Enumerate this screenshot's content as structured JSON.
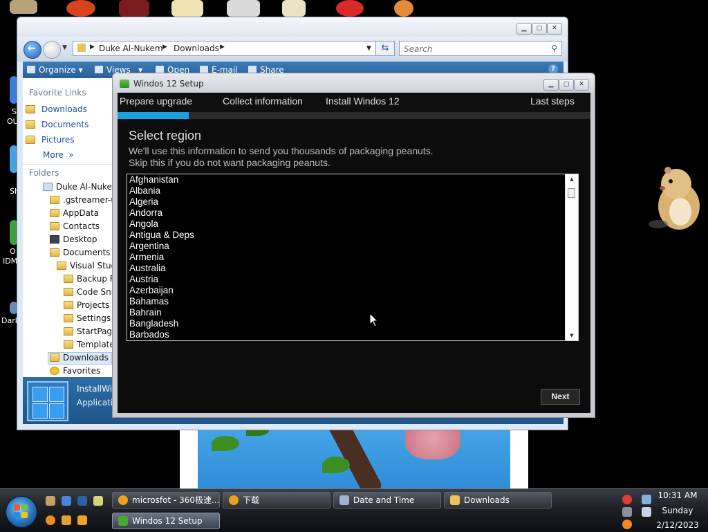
{
  "explorer": {
    "address": [
      "Duke Al-Nukem",
      "Downloads"
    ],
    "search_placeholder": "Search",
    "toolbar": {
      "organize": "Organize",
      "views": "Views",
      "open": "Open",
      "email": "E-mail",
      "share": "Share"
    },
    "favorite_links": {
      "heading": "Favorite Links",
      "items": [
        "Downloads",
        "Documents",
        "Pictures"
      ],
      "more": "More"
    },
    "folders_heading": "Folders",
    "tree": [
      "Duke Al-Nukem",
      ".gstreamer-0.",
      "AppData",
      "Contacts",
      "Desktop",
      "Documents",
      "Visual Studi",
      "Backup Fi",
      "Code Snip",
      "Projects",
      "Settings",
      "StartPage",
      "Template",
      "Downloads",
      "Favorites"
    ],
    "details": {
      "name": "InstallWi",
      "type": "Applicatio"
    }
  },
  "setup": {
    "title": "Windos 12 Setup",
    "steps": [
      "Prepare upgrade",
      "Collect information",
      "Install Windos 12",
      "Last steps"
    ],
    "progress_percent": 15,
    "heading": "Select region",
    "description_lines": [
      "We'll use this information to send you thousands of packaging peanuts.",
      "Skip this if you do not want packaging peanuts."
    ],
    "regions": [
      "Afghanistan",
      "Albania",
      "Algeria",
      "Andorra",
      "Angola",
      "Antigua & Deps",
      "Argentina",
      "Armenia",
      "Australia",
      "Austria",
      "Azerbaijan",
      "Bahamas",
      "Bahrain",
      "Bangladesh",
      "Barbados"
    ],
    "next_label": "Next"
  },
  "taskbar": {
    "tasks_row1": [
      "microsfot - 360极速...",
      "下载",
      "Date and Time",
      "Downloads"
    ],
    "tasks_row2": [
      "Windos 12 Setup"
    ],
    "clock": {
      "time": "10:31 AM",
      "day": "Sunday",
      "date": "2/12/2023"
    }
  },
  "desktop_icon_fragments": [
    "S",
    "OU",
    "Sh",
    "O",
    "IDM",
    "Dark"
  ],
  "colors": {
    "progress": "#1ba1e2",
    "setup_bg": "#0c0c0c",
    "explorer_toolbar": "#2a5f97"
  }
}
